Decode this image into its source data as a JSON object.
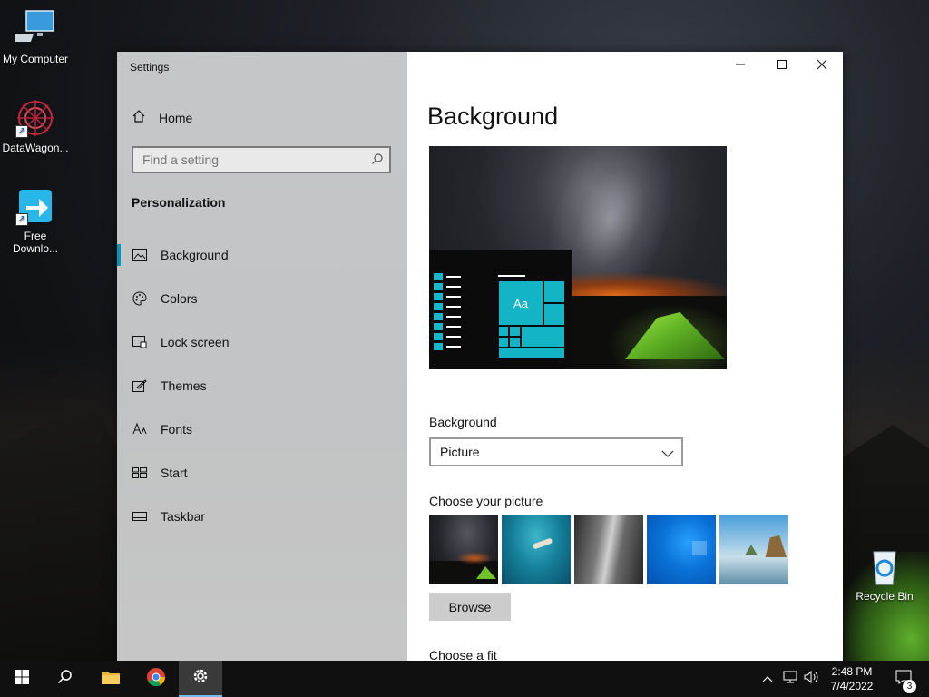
{
  "desktop": {
    "icons": [
      {
        "label": "My Computer"
      },
      {
        "label": "DataWagon..."
      },
      {
        "label": "Free Downlo..."
      },
      {
        "label": "Recycle Bin"
      }
    ]
  },
  "settings": {
    "window_title": "Settings",
    "sidebar": {
      "home_label": "Home",
      "search_placeholder": "Find a setting",
      "section_title": "Personalization",
      "items": [
        {
          "label": "Background",
          "icon": "picture-icon",
          "active": true
        },
        {
          "label": "Colors",
          "icon": "palette-icon"
        },
        {
          "label": "Lock screen",
          "icon": "lock-screen-icon"
        },
        {
          "label": "Themes",
          "icon": "themes-icon"
        },
        {
          "label": "Fonts",
          "icon": "fonts-icon"
        },
        {
          "label": "Start",
          "icon": "start-icon"
        },
        {
          "label": "Taskbar",
          "icon": "taskbar-icon"
        }
      ]
    },
    "main": {
      "heading": "Background",
      "preview_tile_label": "Aa",
      "background_label": "Background",
      "background_value": "Picture",
      "choose_picture_label": "Choose your picture",
      "browse_label": "Browse",
      "choose_fit_label": "Choose a fit"
    }
  },
  "taskbar": {
    "time": "2:48 PM",
    "date": "7/4/2022",
    "notification_count": "3"
  },
  "colors": {
    "accent": "#0099bc",
    "tile": "#12b4c5"
  }
}
